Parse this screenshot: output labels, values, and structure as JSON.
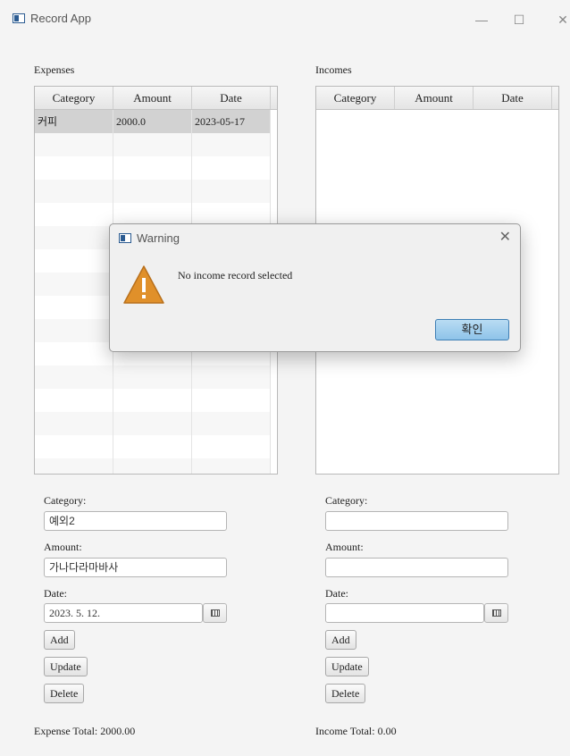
{
  "window": {
    "title": "Record App",
    "minimize": "—",
    "maximize": "☐",
    "close": "✕"
  },
  "expenses": {
    "label": "Expenses",
    "columns": [
      "Category",
      "Amount",
      "Date"
    ],
    "rows": [
      {
        "category": "커피",
        "amount": "2000.0",
        "date": "2023-05-17"
      }
    ],
    "form": {
      "category_label": "Category:",
      "category_value": "예외2",
      "amount_label": "Amount:",
      "amount_value": "가나다라마바사",
      "date_label": "Date:",
      "date_value": "2023. 5. 12."
    },
    "buttons": {
      "add": "Add",
      "update": "Update",
      "delete": "Delete"
    },
    "total": "Expense Total: 2000.00"
  },
  "incomes": {
    "label": "Incomes",
    "columns": [
      "Category",
      "Amount",
      "Date"
    ],
    "form": {
      "category_label": "Category:",
      "category_value": "",
      "amount_label": "Amount:",
      "amount_value": "",
      "date_label": "Date:",
      "date_value": ""
    },
    "buttons": {
      "add": "Add",
      "update": "Update",
      "delete": "Delete"
    },
    "total": "Income Total: 0.00"
  },
  "dialog": {
    "title": "Warning",
    "close": "✕",
    "icon": "warning-icon",
    "message": "No income record selected",
    "ok": "확인"
  },
  "colors": {
    "selected_row": "#d2d2d2",
    "ok_button": "#9ccbeb",
    "warning_icon": "#e0902a"
  }
}
